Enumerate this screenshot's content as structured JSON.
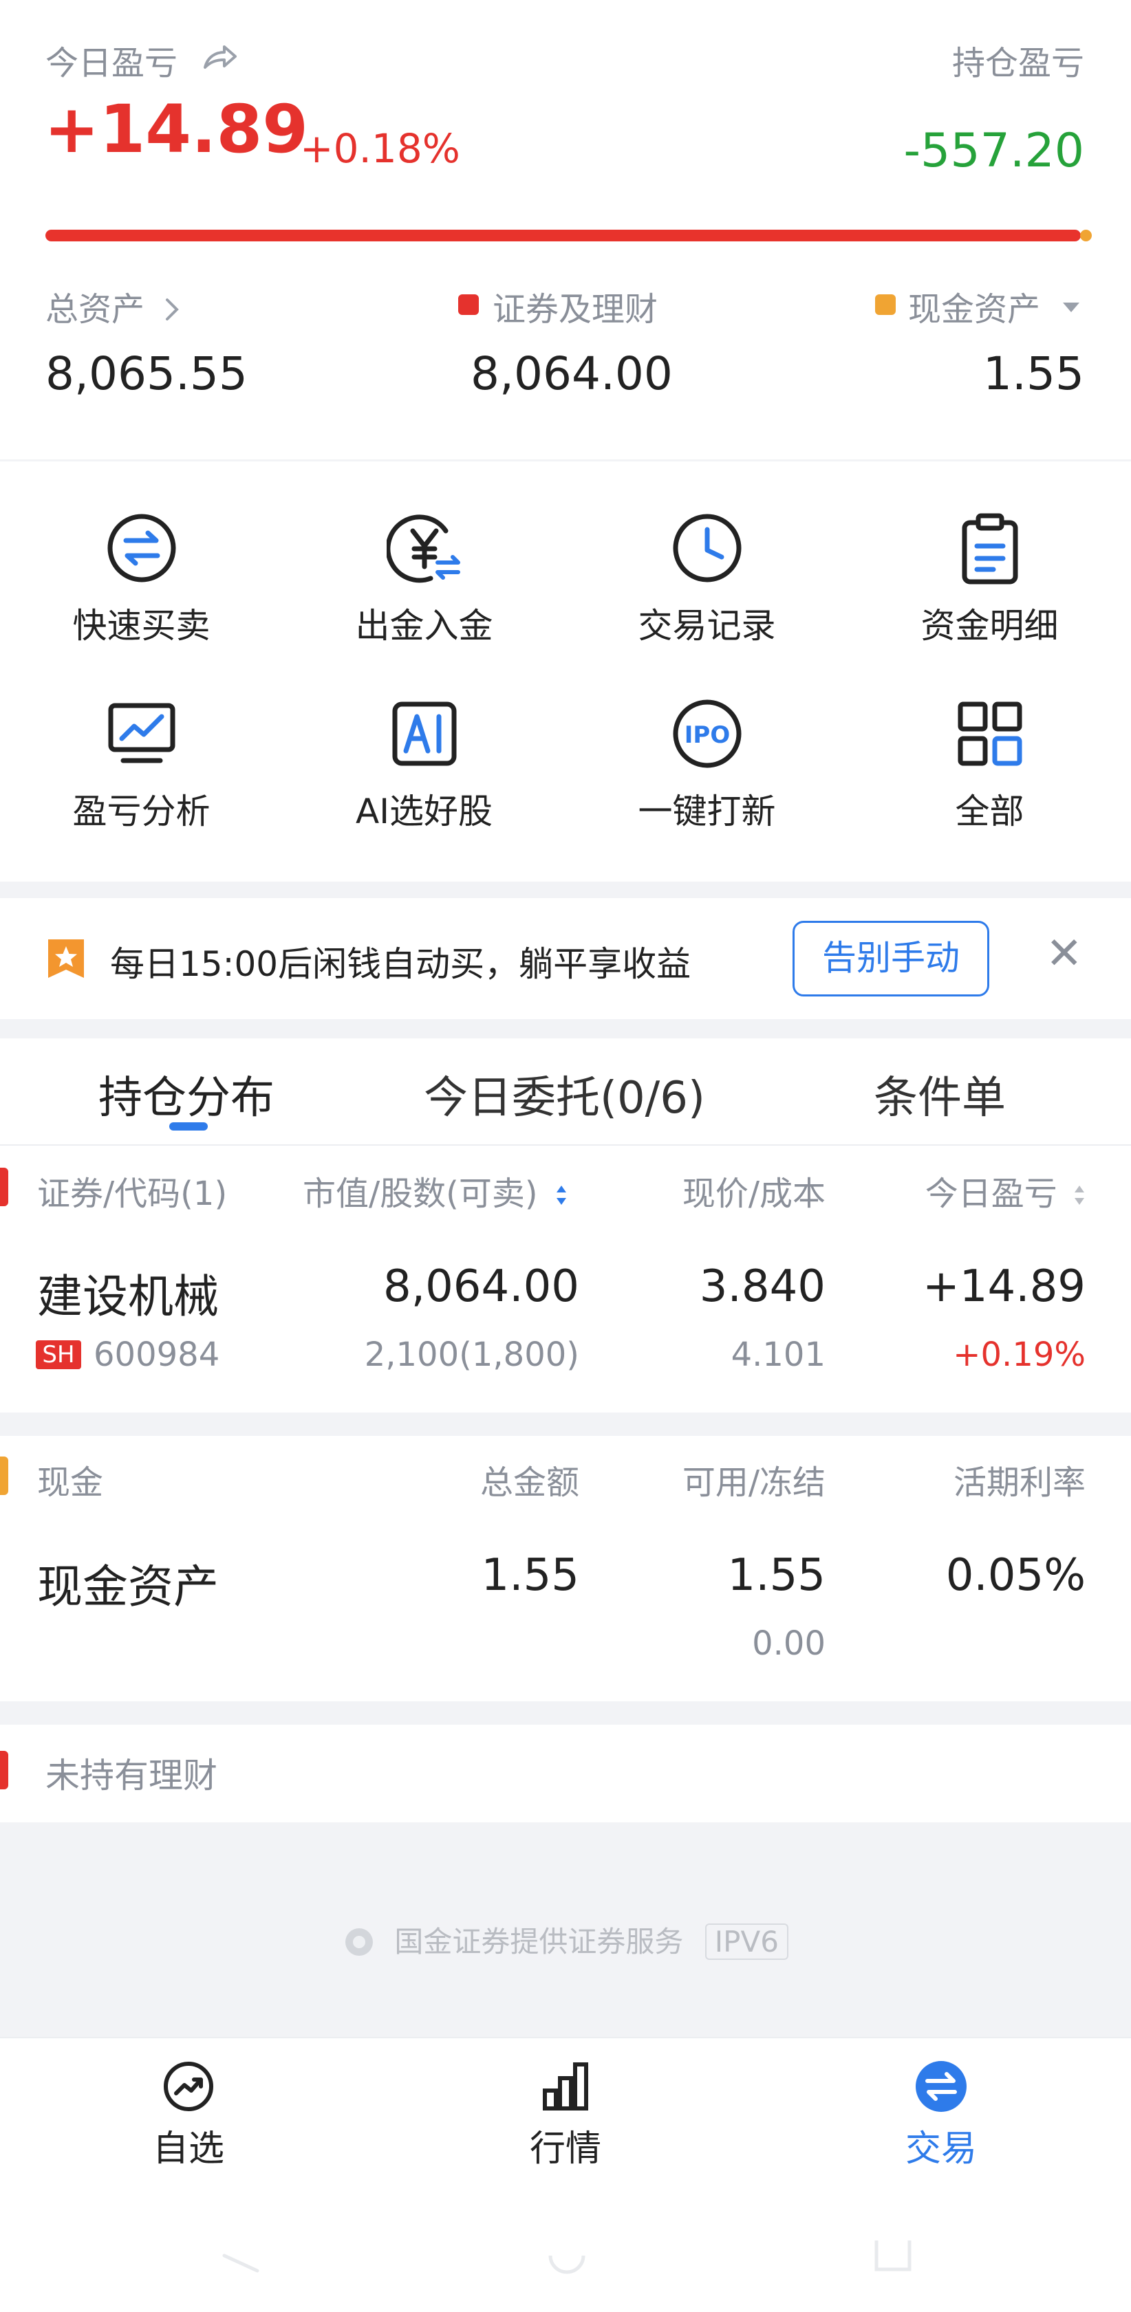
{
  "summary": {
    "today_pl_label": "今日盈亏",
    "today_pl_value": "+14.89",
    "today_pl_pct": "+0.18%",
    "position_pl_label": "持仓盈亏",
    "position_pl_value": "-557.20",
    "securities_share": 0.998,
    "total_assets_label": "总资产",
    "total_assets_value": "8,065.55",
    "securities_label": "证券及理财",
    "securities_value": "8,064.00",
    "cash_label": "现金资产",
    "cash_value": "1.55"
  },
  "quick_menu": [
    {
      "label": "快速买卖",
      "icon": "swap-circle-icon"
    },
    {
      "label": "出金入金",
      "icon": "yuan-transfer-icon"
    },
    {
      "label": "交易记录",
      "icon": "clock-icon"
    },
    {
      "label": "资金明细",
      "icon": "clipboard-icon"
    },
    {
      "label": "盈亏分析",
      "icon": "monitor-chart-icon"
    },
    {
      "label": "AI选好股",
      "icon": "ai-icon"
    },
    {
      "label": "一键打新",
      "icon": "ipo-icon"
    },
    {
      "label": "全部",
      "icon": "grid-icon"
    }
  ],
  "promo": {
    "text": "每日15:00后闲钱自动买，躺平享收益",
    "button": "告别手动",
    "close_glyph": "✕"
  },
  "tabs": [
    {
      "label": "持仓分布",
      "active": true
    },
    {
      "label": "今日委托(0/6)",
      "active": false
    },
    {
      "label": "条件单",
      "active": false
    }
  ],
  "holdings": {
    "headers": {
      "security": "证券/代码(1)",
      "market_value": "市值/股数(可卖)",
      "price": "现价/成本",
      "today_pl": "今日盈亏"
    },
    "rows": [
      {
        "name": "建设机械",
        "market": "SH",
        "code": "600984",
        "market_value": "8,064.00",
        "shares": "2,100(1,800)",
        "price": "3.840",
        "cost": "4.101",
        "today_pl": "+14.89",
        "today_pl_pct": "+0.19%"
      }
    ]
  },
  "cash": {
    "headers": {
      "section": "现金",
      "total": "总金额",
      "available": "可用/冻结",
      "rate": "活期利率"
    },
    "row": {
      "name": "现金资产",
      "total": "1.55",
      "available": "1.55",
      "frozen": "0.00",
      "rate": "0.05%"
    }
  },
  "finance": {
    "label": "未持有理财"
  },
  "footer": {
    "text": "国金证券提供证券服务",
    "badge": "IPV6"
  },
  "nav": [
    {
      "label": "自选",
      "icon": "trend-circle-icon",
      "active": false
    },
    {
      "label": "行情",
      "icon": "bar-chart-icon",
      "active": false
    },
    {
      "label": "交易",
      "icon": "exchange-icon",
      "active": true
    }
  ],
  "colors": {
    "up": "#e5322d",
    "down": "#26a23a",
    "accent": "#2e7bea",
    "cash_marker": "#f0a433"
  }
}
